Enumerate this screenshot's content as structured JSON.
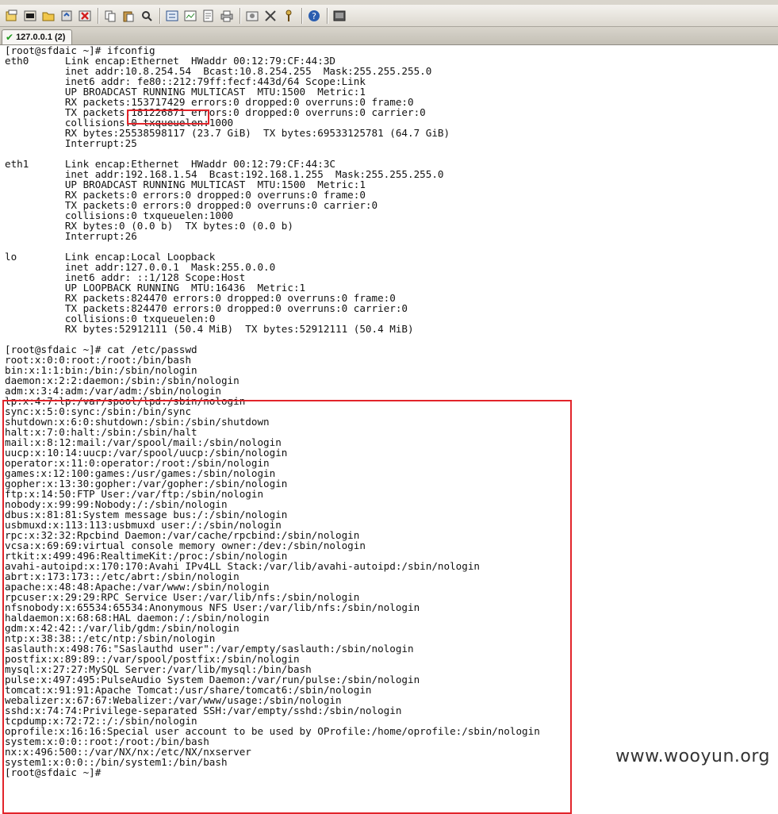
{
  "tab": {
    "label": "127.0.0.1 (2)"
  },
  "terminal": {
    "lines": [
      "[root@sfdaic ~]# ifconfig",
      "eth0      Link encap:Ethernet  HWaddr 00:12:79:CF:44:3D",
      "          inet addr:10.8.254.54  Bcast:10.8.254.255  Mask:255.255.255.0",
      "          inet6 addr: fe80::212:79ff:fecf:443d/64 Scope:Link",
      "          UP BROADCAST RUNNING MULTICAST  MTU:1500  Metric:1",
      "          RX packets:153717429 errors:0 dropped:0 overruns:0 frame:0",
      "          TX packets:181226871 errors:0 dropped:0 overruns:0 carrier:0",
      "          collisions:0 txqueuelen:1000",
      "          RX bytes:25538598117 (23.7 GiB)  TX bytes:69533125781 (64.7 GiB)",
      "          Interrupt:25",
      "",
      "eth1      Link encap:Ethernet  HWaddr 00:12:79:CF:44:3C",
      "          inet addr:192.168.1.54  Bcast:192.168.1.255  Mask:255.255.255.0",
      "          UP BROADCAST RUNNING MULTICAST  MTU:1500  Metric:1",
      "          RX packets:0 errors:0 dropped:0 overruns:0 frame:0",
      "          TX packets:0 errors:0 dropped:0 overruns:0 carrier:0",
      "          collisions:0 txqueuelen:1000",
      "          RX bytes:0 (0.0 b)  TX bytes:0 (0.0 b)",
      "          Interrupt:26",
      "",
      "lo        Link encap:Local Loopback",
      "          inet addr:127.0.0.1  Mask:255.0.0.0",
      "          inet6 addr: ::1/128 Scope:Host",
      "          UP LOOPBACK RUNNING  MTU:16436  Metric:1",
      "          RX packets:824470 errors:0 dropped:0 overruns:0 frame:0",
      "          TX packets:824470 errors:0 dropped:0 overruns:0 carrier:0",
      "          collisions:0 txqueuelen:0",
      "          RX bytes:52912111 (50.4 MiB)  TX bytes:52912111 (50.4 MiB)",
      "",
      "[root@sfdaic ~]# cat /etc/passwd",
      "root:x:0:0:root:/root:/bin/bash",
      "bin:x:1:1:bin:/bin:/sbin/nologin",
      "daemon:x:2:2:daemon:/sbin:/sbin/nologin",
      "adm:x:3:4:adm:/var/adm:/sbin/nologin",
      "lp:x:4:7:lp:/var/spool/lpd:/sbin/nologin",
      "sync:x:5:0:sync:/sbin:/bin/sync",
      "shutdown:x:6:0:shutdown:/sbin:/sbin/shutdown",
      "halt:x:7:0:halt:/sbin:/sbin/halt",
      "mail:x:8:12:mail:/var/spool/mail:/sbin/nologin",
      "uucp:x:10:14:uucp:/var/spool/uucp:/sbin/nologin",
      "operator:x:11:0:operator:/root:/sbin/nologin",
      "games:x:12:100:games:/usr/games:/sbin/nologin",
      "gopher:x:13:30:gopher:/var/gopher:/sbin/nologin",
      "ftp:x:14:50:FTP User:/var/ftp:/sbin/nologin",
      "nobody:x:99:99:Nobody:/:/sbin/nologin",
      "dbus:x:81:81:System message bus:/:/sbin/nologin",
      "usbmuxd:x:113:113:usbmuxd user:/:/sbin/nologin",
      "rpc:x:32:32:Rpcbind Daemon:/var/cache/rpcbind:/sbin/nologin",
      "vcsa:x:69:69:virtual console memory owner:/dev:/sbin/nologin",
      "rtkit:x:499:496:RealtimeKit:/proc:/sbin/nologin",
      "avahi-autoipd:x:170:170:Avahi IPv4LL Stack:/var/lib/avahi-autoipd:/sbin/nologin",
      "abrt:x:173:173::/etc/abrt:/sbin/nologin",
      "apache:x:48:48:Apache:/var/www:/sbin/nologin",
      "rpcuser:x:29:29:RPC Service User:/var/lib/nfs:/sbin/nologin",
      "nfsnobody:x:65534:65534:Anonymous NFS User:/var/lib/nfs:/sbin/nologin",
      "haldaemon:x:68:68:HAL daemon:/:/sbin/nologin",
      "gdm:x:42:42::/var/lib/gdm:/sbin/nologin",
      "ntp:x:38:38::/etc/ntp:/sbin/nologin",
      "saslauth:x:498:76:\"Saslauthd user\":/var/empty/saslauth:/sbin/nologin",
      "postfix:x:89:89::/var/spool/postfix:/sbin/nologin",
      "mysql:x:27:27:MySQL Server:/var/lib/mysql:/bin/bash",
      "pulse:x:497:495:PulseAudio System Daemon:/var/run/pulse:/sbin/nologin",
      "tomcat:x:91:91:Apache Tomcat:/usr/share/tomcat6:/sbin/nologin",
      "webalizer:x:67:67:Webalizer:/var/www/usage:/sbin/nologin",
      "sshd:x:74:74:Privilege-separated SSH:/var/empty/sshd:/sbin/nologin",
      "tcpdump:x:72:72::/:/sbin/nologin",
      "oprofile:x:16:16:Special user account to be used by OProfile:/home/oprofile:/sbin/nologin",
      "system:x:0:0::root:/root:/bin/bash",
      "nx:x:496:500::/var/NX/nx:/etc/NX/nxserver",
      "system1:x:0:0::/bin/system1:/bin/bash",
      "[root@sfdaic ~]# "
    ]
  },
  "watermark": "www.wooyun.org",
  "colors": {
    "highlight": "#e2242a",
    "tab_check": "#1f9a1f"
  }
}
